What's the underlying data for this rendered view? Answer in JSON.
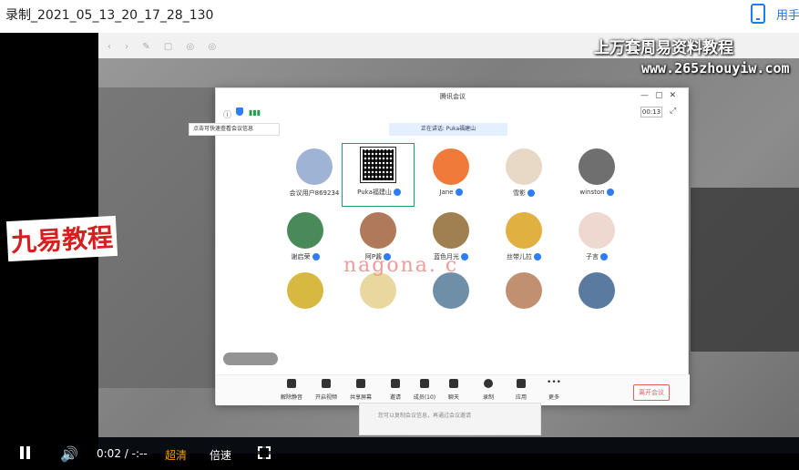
{
  "window": {
    "title": "录制_2021_05_13_20_17_28_130",
    "handheld_label": "用手"
  },
  "overlay": {
    "watermark_line1": "上万套周易资料教程",
    "watermark_line2": "www.265zhouyiw.com",
    "logo_text": "九易教程",
    "site_watermark": "nagona. c"
  },
  "meeting": {
    "title": "腾讯会议",
    "timer": "00:13",
    "tooltip": "点击可快速查看会议信息",
    "speaking_banner": "正在讲话: Puka福建山",
    "participants": [
      {
        "name": "会议用户869234",
        "avatar_color": "#9fb3d4"
      },
      {
        "name": "Puka福建山",
        "avatar_color": "#ffffff"
      },
      {
        "name": "Jane",
        "avatar_color": "#f07a3a"
      },
      {
        "name": "雪影",
        "avatar_color": "#e8d9c6"
      },
      {
        "name": "winston",
        "avatar_color": "#6f6f6f"
      },
      {
        "name": "谢启荣",
        "avatar_color": "#4a8a5a"
      },
      {
        "name": "阿P酱",
        "avatar_color": "#b07a5a"
      },
      {
        "name": "蓝色月光",
        "avatar_color": "#a08050"
      },
      {
        "name": "丝带儿拉",
        "avatar_color": "#e0b040"
      },
      {
        "name": "子言",
        "avatar_color": "#eed8d0"
      },
      {
        "name": "",
        "avatar_color": "#d7b840"
      },
      {
        "name": "",
        "avatar_color": "#e8d8a0"
      },
      {
        "name": "",
        "avatar_color": "#6f8fa8"
      },
      {
        "name": "",
        "avatar_color": "#c09070"
      },
      {
        "name": "",
        "avatar_color": "#5a7aa0"
      }
    ],
    "toolbar": [
      {
        "label": "解除静音",
        "icon": "microphone-icon"
      },
      {
        "label": "开启视频",
        "icon": "camera-icon"
      },
      {
        "label": "共享屏幕",
        "icon": "screen-share-icon"
      },
      {
        "label": "邀请",
        "icon": "invite-icon"
      },
      {
        "label": "成员(10)",
        "icon": "members-icon"
      },
      {
        "label": "聊天",
        "icon": "chat-icon"
      },
      {
        "label": "录制",
        "icon": "record-icon"
      },
      {
        "label": "应用",
        "icon": "apps-icon"
      },
      {
        "label": "更多",
        "icon": "more-icon"
      }
    ],
    "leave_label": "离开会议",
    "subpanel_text": "您可以复制会议信息，再通过会议邀请"
  },
  "player": {
    "current_time": "0:02",
    "separator": "/",
    "duration": "-:--",
    "quality_label": "超清",
    "speed_label": "倍速"
  }
}
